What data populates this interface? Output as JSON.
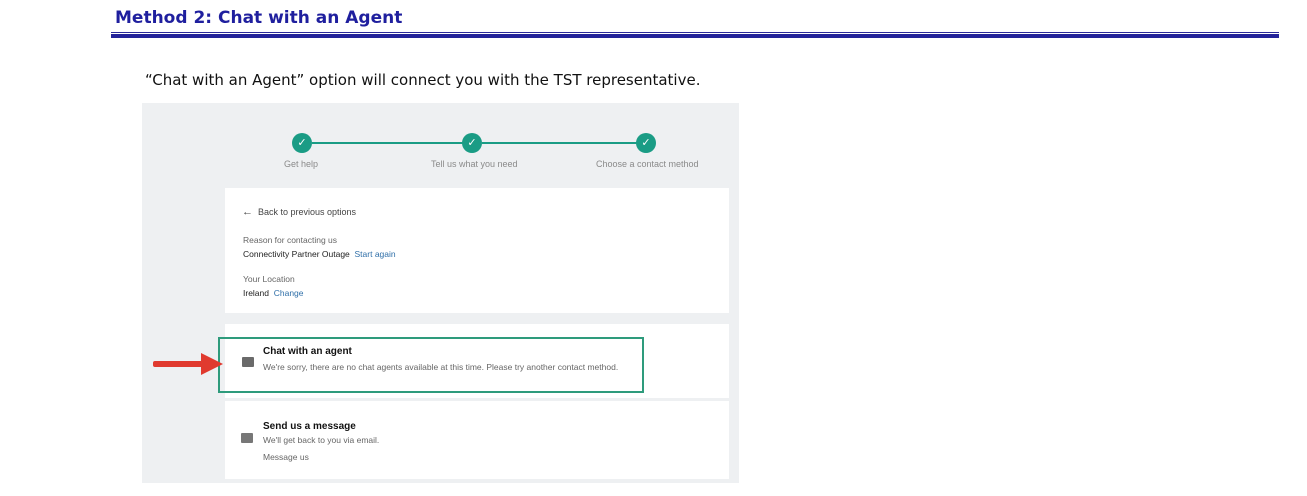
{
  "heading": "Method 2: Chat with an Agent",
  "intro": "“Chat with an Agent” option will connect you with the TST representative.",
  "steps": [
    {
      "label": "Get help"
    },
    {
      "label": "Tell us what you need"
    },
    {
      "label": "Choose a contact method"
    }
  ],
  "check_glyph": "✓",
  "back_arrow": "←",
  "info": {
    "back": "Back to previous options",
    "reason_label": "Reason for contacting us",
    "reason_value": "Connectivity Partner Outage",
    "reason_link": "Start again",
    "location_label": "Your Location",
    "location_value": "Ireland",
    "location_link": "Change"
  },
  "options": {
    "chat_title": "Chat with an agent",
    "chat_sub": "We're sorry, there are no chat agents available at this time. Please try another contact method.",
    "message_title": "Send us a message",
    "message_sub": "We'll get back to you via email.",
    "message_link": "Message us"
  },
  "colors": {
    "accent": "#1a9c85",
    "heading": "#1f1f9e",
    "arrow": "#e03a2f"
  }
}
